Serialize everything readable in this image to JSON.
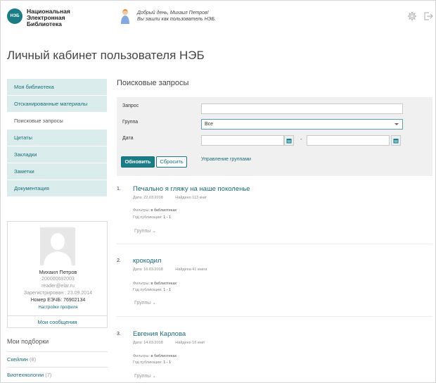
{
  "header": {
    "logo_abbr": "НЭБ",
    "logo_lines": [
      "Национальная",
      "Электронная",
      "Библиотека"
    ],
    "greeting_line1": "Добрый день, Михаил Петров!",
    "greeting_line2": "Вы зашли как пользователь НЭБ."
  },
  "page_title": "Личный кабинет пользователя НЭБ",
  "menu": [
    {
      "label": "Моя библиотека",
      "active": false
    },
    {
      "label": "Отсканированные материалы",
      "active": false
    },
    {
      "label": "Поисковые запросы",
      "active": true
    },
    {
      "label": "Цитаты",
      "active": false
    },
    {
      "label": "Закладки",
      "active": false
    },
    {
      "label": "Заметки",
      "active": false
    },
    {
      "label": "Документация",
      "active": false
    }
  ],
  "profile": {
    "name": "Михаил Петров",
    "id": "200000692003",
    "email": "reader@elar.ru",
    "registered": "Зарегистрирован : 23.09.2014",
    "ticket": "Номер ЕЭЧБ: 76902134",
    "settings_link": "Настройки профиля",
    "messages": "Мои сообщения"
  },
  "collections": {
    "title": "Мои подборки",
    "items": [
      {
        "label": "Скейлин",
        "count": "(8)"
      },
      {
        "label": "Биотехнологии",
        "count": "(7)"
      }
    ]
  },
  "search": {
    "title": "Поисковые запросы",
    "query_label": "Запрос",
    "query_value": "",
    "group_label": "Группа",
    "group_value": "Все",
    "date_label": "Дата",
    "date_from": "",
    "date_to": "",
    "date_separator": "-",
    "refresh_button": "Обновить",
    "reset_button": "Сбросить",
    "manage_groups": "Управление группами"
  },
  "results": [
    {
      "num": "1.",
      "title": "Печально я гляжу на наше поколенье",
      "date": "Дата: 22.03.2018",
      "found": "Найдено 113 книг",
      "filters_label": "Фильтры:",
      "filters_value": "в библиотеках",
      "years_label": "Год публикации:",
      "years_value": "1 - 1",
      "groups": "Группы"
    },
    {
      "num": "2.",
      "title": "крокодил",
      "date": "Дата: 16.03.2018",
      "found": "Найдена 41 книга",
      "filters_label": "Фильтры:",
      "filters_value": "в библиотеках",
      "years_label": "Год публикации:",
      "years_value": "1 - 1",
      "groups": "Группы"
    },
    {
      "num": "3.",
      "title": "Евгения Карлова",
      "date": "Дата: 14.03.2018",
      "found": "Найдено 16 книг",
      "filters_label": "Фильтры:",
      "filters_value": "в библиотеках",
      "years_label": "Год публикации:",
      "years_value": "1 - 1",
      "groups": "Группы"
    }
  ],
  "colors": {
    "accent": "#1b7c86",
    "menu_bg": "#dbecec",
    "panel_bg": "#f0f0f0"
  }
}
